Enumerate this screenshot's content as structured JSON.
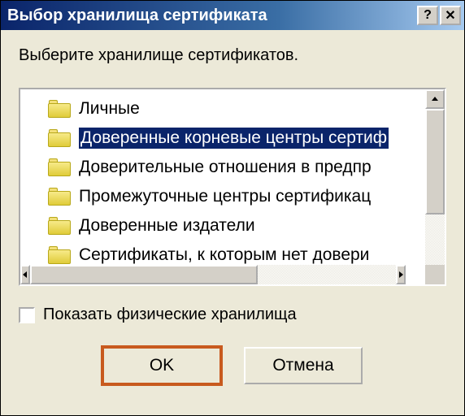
{
  "title": "Выбор хранилища сертификата",
  "instruction": "Выберите хранилище сертификатов.",
  "tree": {
    "items": [
      {
        "label": "Личные",
        "selected": false
      },
      {
        "label": "Доверенные корневые центры сертиф",
        "selected": true
      },
      {
        "label": "Доверительные отношения в предпр",
        "selected": false
      },
      {
        "label": "Промежуточные центры сертификац",
        "selected": false
      },
      {
        "label": "Доверенные издатели",
        "selected": false
      },
      {
        "label": "Сертификаты, к которым нет довери",
        "selected": false
      }
    ]
  },
  "checkbox": {
    "label": "Показать физические хранилища",
    "checked": false
  },
  "buttons": {
    "ok": "OK",
    "cancel": "Отмена"
  },
  "titlebar": {
    "help": "?",
    "close": "✕"
  }
}
